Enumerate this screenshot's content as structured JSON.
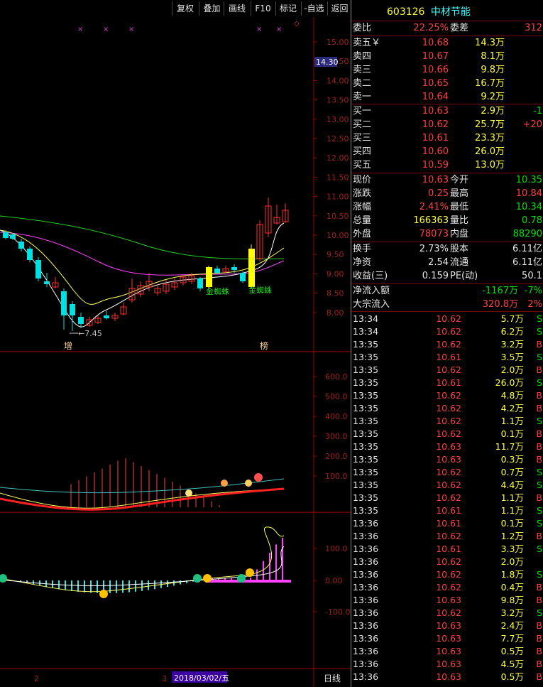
{
  "toolbar": {
    "buttons": [
      "复权",
      "叠加",
      "画线",
      "F10",
      "标记",
      "-自选",
      "返回"
    ]
  },
  "chart": {
    "price_axis": [
      "15.00",
      "14.50",
      "14.00",
      "13.50",
      "13.00",
      "12.50",
      "12.00",
      "11.50",
      "11.00",
      "10.50",
      "10.00",
      "9.50",
      "9.00",
      "8.50",
      "8.00"
    ],
    "current_price_tag": "14.30",
    "low_marker": "7.45",
    "pattern_label_1": "金蜘蛛",
    "pattern_label_2": "金蜘蛛",
    "event_label_1": "增",
    "event_label_2": "榜",
    "vol_axis": [
      "600.0",
      "500.0",
      "400.0",
      "300.0",
      "200.0",
      "100.0"
    ],
    "macd_axis": [
      "100.0",
      "0.00",
      "-100.0"
    ],
    "bottom_label_1": "2",
    "bottom_label_2": "3",
    "date_label": "2018/03/02/五",
    "period_label": "日线",
    "colors": {
      "up": "#ff3030",
      "down": "#00e0e0",
      "ma_yellow": "#ffff60",
      "ma_magenta": "#ff40ff",
      "ma_green": "#20d020",
      "ma_white": "#ffffff"
    }
  },
  "quote": {
    "code": "603126",
    "name": "中材节能",
    "weibi_label": "委比",
    "weibi_value": "22.25%",
    "weicha_label": "委差",
    "weicha_value": "312",
    "asks": [
      {
        "label": "卖五￥",
        "price": "10.68",
        "vol": "14.3万"
      },
      {
        "label": "卖四",
        "price": "10.67",
        "vol": "8.1万"
      },
      {
        "label": "卖三",
        "price": "10.66",
        "vol": "9.8万"
      },
      {
        "label": "卖二",
        "price": "10.65",
        "vol": "16.7万"
      },
      {
        "label": "卖一",
        "price": "10.64",
        "vol": "9.2万"
      }
    ],
    "bids": [
      {
        "label": "买一",
        "price": "10.63",
        "vol": "2.9万",
        "chg": "-1"
      },
      {
        "label": "买二",
        "price": "10.62",
        "vol": "25.7万",
        "chg": "+20"
      },
      {
        "label": "买三",
        "price": "10.61",
        "vol": "23.3万",
        "chg": ""
      },
      {
        "label": "买四",
        "price": "10.60",
        "vol": "26.0万",
        "chg": ""
      },
      {
        "label": "买五",
        "price": "10.59",
        "vol": "13.0万",
        "chg": ""
      }
    ],
    "stats": [
      {
        "l1": "现价",
        "v1": "10.63",
        "c1": "red",
        "l2": "今开",
        "v2": "10.35",
        "c2": "grn"
      },
      {
        "l1": "涨跌",
        "v1": "0.25",
        "c1": "red",
        "l2": "最高",
        "v2": "10.84",
        "c2": "red"
      },
      {
        "l1": "涨幅",
        "v1": "2.41%",
        "c1": "red",
        "l2": "最低",
        "v2": "10.34",
        "c2": "grn"
      },
      {
        "l1": "总量",
        "v1": "166363",
        "c1": "yel",
        "l2": "量比",
        "v2": "0.78",
        "c2": "grn"
      },
      {
        "l1": "外盘",
        "v1": "78073",
        "c1": "red",
        "l2": "内盘",
        "v2": "88290",
        "c2": "grn"
      }
    ],
    "fund": [
      {
        "l1": "换手",
        "v1": "2.73%",
        "l2": "股本",
        "v2": "6.11亿"
      },
      {
        "l1": "净资",
        "v1": "2.54",
        "l2": "流通",
        "v2": "6.11亿"
      },
      {
        "l1": "收益(三)",
        "v1": "0.159",
        "l2": "PE(动)",
        "v2": "50.1"
      }
    ],
    "flow": [
      {
        "label": "净流入额",
        "value": "-1167万",
        "pct": "-7%",
        "color": "grn"
      },
      {
        "label": "大宗流入",
        "value": "320.8万",
        "pct": "2%",
        "color": "red"
      }
    ],
    "trades": [
      {
        "t": "13:34",
        "p": "10.62",
        "v": "5.7万",
        "s": "S"
      },
      {
        "t": "13:34",
        "p": "10.62",
        "v": "6.2万",
        "s": "S"
      },
      {
        "t": "13:35",
        "p": "10.62",
        "v": "3.2万",
        "s": "B"
      },
      {
        "t": "13:35",
        "p": "10.61",
        "v": "3.5万",
        "s": "S"
      },
      {
        "t": "13:35",
        "p": "10.62",
        "v": "2.0万",
        "s": "B"
      },
      {
        "t": "13:35",
        "p": "10.61",
        "v": "26.0万",
        "s": "S"
      },
      {
        "t": "13:35",
        "p": "10.62",
        "v": "4.8万",
        "s": "B"
      },
      {
        "t": "13:35",
        "p": "10.62",
        "v": "4.2万",
        "s": "B"
      },
      {
        "t": "13:35",
        "p": "10.62",
        "v": "1.1万",
        "s": "S"
      },
      {
        "t": "13:35",
        "p": "10.62",
        "v": "0.1万",
        "s": "B"
      },
      {
        "t": "13:35",
        "p": "10.63",
        "v": "11.7万",
        "s": "B"
      },
      {
        "t": "13:35",
        "p": "10.63",
        "v": "0.3万",
        "s": "B"
      },
      {
        "t": "13:35",
        "p": "10.62",
        "v": "0.7万",
        "s": "S"
      },
      {
        "t": "13:35",
        "p": "10.62",
        "v": "4.4万",
        "s": "S"
      },
      {
        "t": "13:35",
        "p": "10.62",
        "v": "1.1万",
        "s": "B"
      },
      {
        "t": "13:35",
        "p": "10.61",
        "v": "1.1万",
        "s": "S"
      },
      {
        "t": "13:36",
        "p": "10.61",
        "v": "0.1万",
        "s": "S"
      },
      {
        "t": "13:36",
        "p": "10.62",
        "v": "1.2万",
        "s": "B"
      },
      {
        "t": "13:36",
        "p": "10.61",
        "v": "3.3万",
        "s": "S"
      },
      {
        "t": "13:36",
        "p": "10.62",
        "v": "2.0万",
        "s": ""
      },
      {
        "t": "13:36",
        "p": "10.62",
        "v": "1.8万",
        "s": "S"
      },
      {
        "t": "13:36",
        "p": "10.62",
        "v": "0.4万",
        "s": "B"
      },
      {
        "t": "13:36",
        "p": "10.63",
        "v": "9.8万",
        "s": "B"
      },
      {
        "t": "13:36",
        "p": "10.62",
        "v": "3.2万",
        "s": "S"
      },
      {
        "t": "13:36",
        "p": "10.63",
        "v": "2.4万",
        "s": "B"
      },
      {
        "t": "13:36",
        "p": "10.63",
        "v": "7.7万",
        "s": "B"
      },
      {
        "t": "13:36",
        "p": "10.63",
        "v": "0.5万",
        "s": "B"
      },
      {
        "t": "13:36",
        "p": "10.63",
        "v": "4.5万",
        "s": "B"
      },
      {
        "t": "13:36",
        "p": "10.63",
        "v": "0.5万",
        "s": "B"
      }
    ]
  }
}
